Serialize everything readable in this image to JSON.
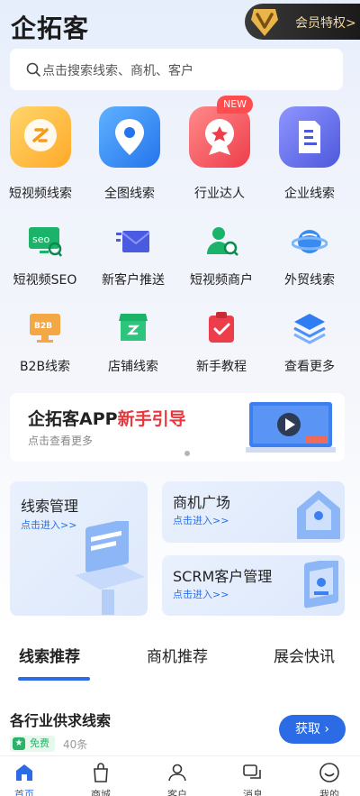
{
  "header": {
    "logo": "企拓客",
    "vip_label": "会员特权>"
  },
  "search": {
    "placeholder": "点击搜索线索、商机、客户"
  },
  "main_features": [
    {
      "label": "短视频线索",
      "icon": "short-video-icon"
    },
    {
      "label": "全图线索",
      "icon": "map-pin-icon"
    },
    {
      "label": "行业达人",
      "icon": "expert-medal-icon",
      "badge": "NEW"
    },
    {
      "label": "企业线索",
      "icon": "building-icon"
    }
  ],
  "tools_row1": [
    {
      "label": "短视频SEO",
      "icon": "seo-monitor-icon"
    },
    {
      "label": "新客户推送",
      "icon": "mail-icon"
    },
    {
      "label": "短视频商户",
      "icon": "merchant-search-icon"
    },
    {
      "label": "外贸线索",
      "icon": "planet-icon"
    }
  ],
  "tools_row2": [
    {
      "label": "B2B线索",
      "icon": "b2b-monitor-icon"
    },
    {
      "label": "店铺线索",
      "icon": "shop-icon"
    },
    {
      "label": "新手教程",
      "icon": "clipboard-check-icon"
    },
    {
      "label": "查看更多",
      "icon": "layers-icon"
    }
  ],
  "banner": {
    "title_prefix": "企拓客APP",
    "title_highlight": "新手引导",
    "subtitle": "点击查看更多"
  },
  "cards": [
    {
      "title": "线索管理",
      "link": "点击进入>>"
    },
    {
      "title": "商机广场",
      "link": "点击进入>>"
    },
    {
      "title": "SCRM客户管理",
      "link": "点击进入>>"
    }
  ],
  "tabs": [
    "线索推荐",
    "商机推荐",
    "展会快讯"
  ],
  "feed": {
    "title": "各行业供求线索",
    "badge": "免费",
    "count": "40条",
    "action": "获取 ›"
  },
  "tabbar": [
    "首页",
    "商城",
    "客户",
    "消息",
    "我的"
  ],
  "colors": {
    "accent": "#2b6be6",
    "highlight": "#e8383d",
    "free_green": "#2ab368"
  }
}
